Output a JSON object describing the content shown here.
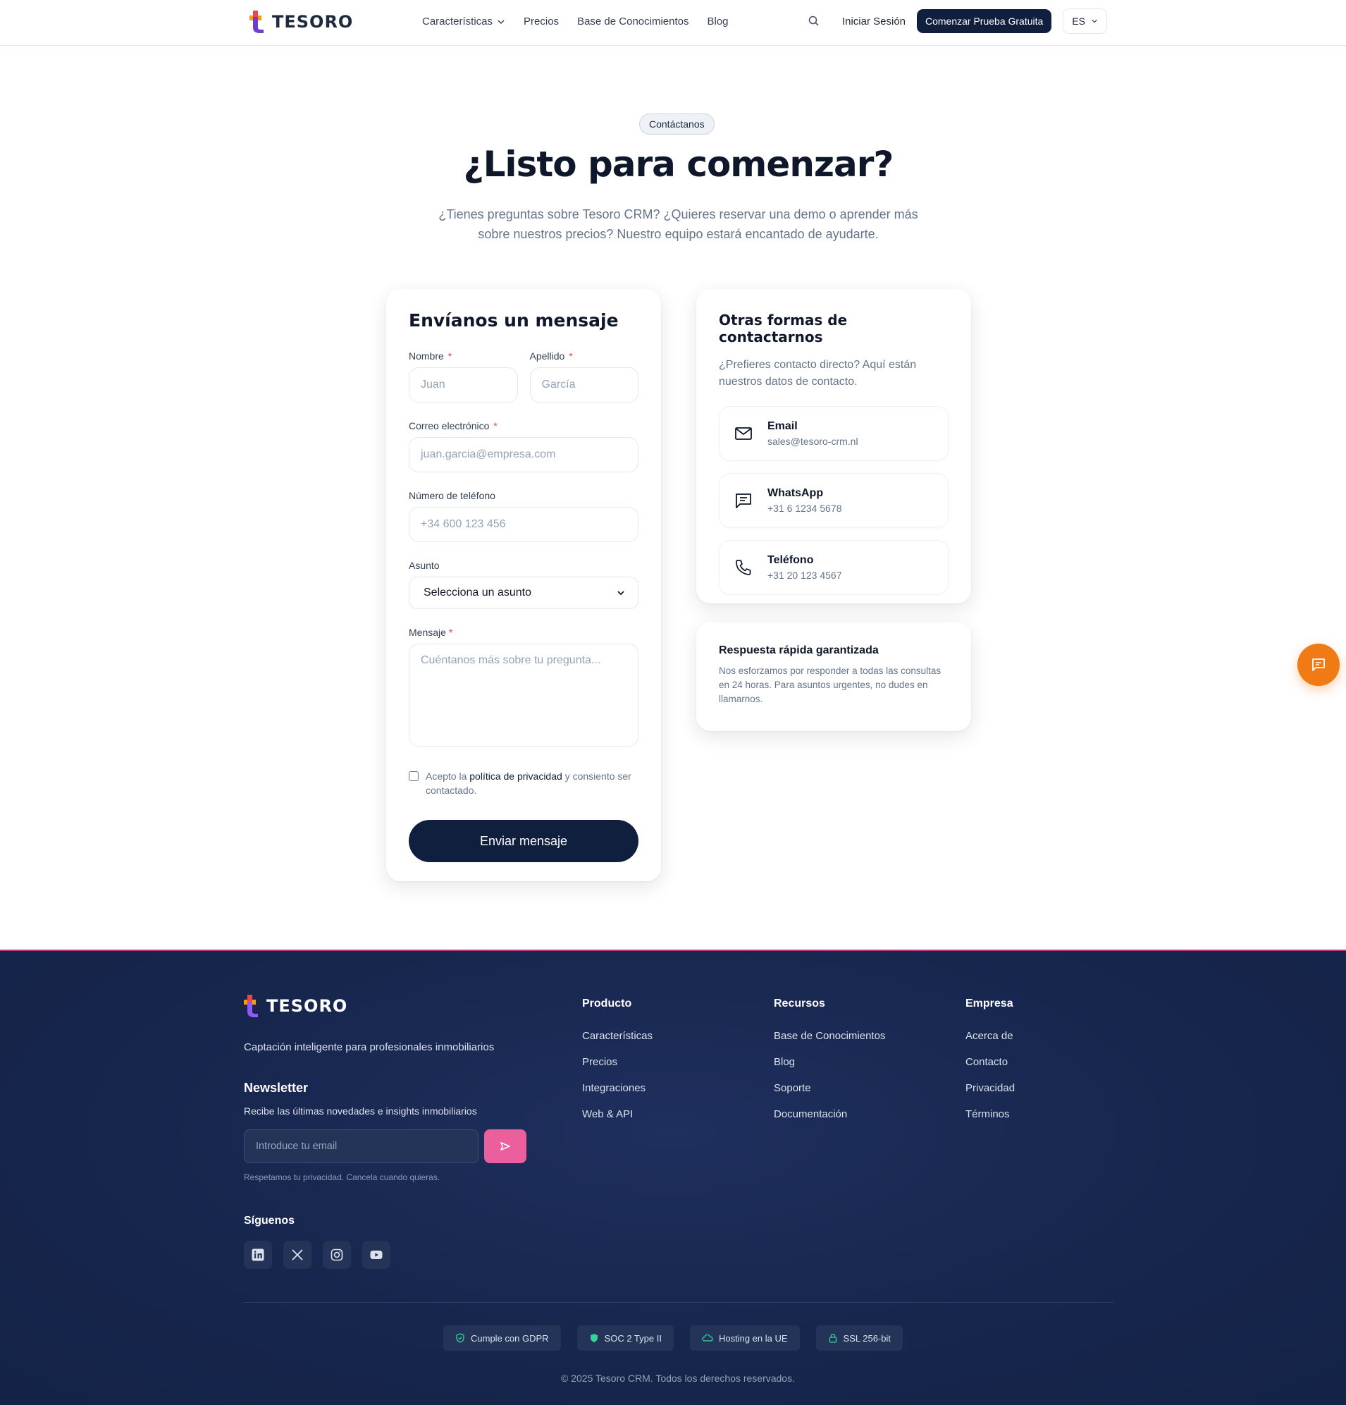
{
  "nav": {
    "brand": "TESORO",
    "links": [
      "Características",
      "Precios",
      "Base de Conocimientos",
      "Blog"
    ],
    "login": "Iniciar Sesión",
    "cta": "Comenzar Prueba Gratuita",
    "language": "ES"
  },
  "hero": {
    "badge": "Contáctanos",
    "title": "¿Listo para comenzar?",
    "subtitle": "¿Tienes preguntas sobre Tesoro CRM? ¿Quieres reservar una demo o aprender más sobre nuestros precios? Nuestro equipo estará encantado de ayudarte."
  },
  "form": {
    "title": "Envíanos un mensaje",
    "first_name_label": "Nombre",
    "first_name_placeholder": "Juan",
    "last_name_label": "Apellido",
    "last_name_placeholder": "García",
    "email_label": "Correo electrónico",
    "email_placeholder": "juan.garcia@empresa.com",
    "phone_label": "Número de teléfono",
    "phone_placeholder": "+34 600 123 456",
    "subject_label": "Asunto",
    "subject_value": "Selecciona un asunto",
    "message_label": "Mensaje",
    "message_placeholder": "Cuéntanos más sobre tu pregunta...",
    "required_mark": "*",
    "consent_prefix": "Acepto la",
    "consent_link": "política de privacidad",
    "consent_suffix": "y consiento ser contactado.",
    "submit": "Enviar mensaje"
  },
  "contact": {
    "title": "Otras formas de contactarnos",
    "subtitle": "¿Prefieres contacto directo? Aquí están nuestros datos de contacto.",
    "items": [
      {
        "title": "Email",
        "value": "sales@tesoro-crm.nl",
        "icon": "mail-icon"
      },
      {
        "title": "WhatsApp",
        "value": "+31 6 1234 5678",
        "icon": "chat-icon"
      },
      {
        "title": "Teléfono",
        "value": "+31 20 123 4567",
        "icon": "phone-icon"
      }
    ]
  },
  "quick": {
    "title": "Respuesta rápida garantizada",
    "text": "Nos esforzamos por responder a todas las consultas en 24 horas. Para asuntos urgentes, no dudes en llamarnos."
  },
  "footer": {
    "brand": "TESORO",
    "tagline": "Captación inteligente para profesionales inmobiliarios",
    "newsletter_title": "Newsletter",
    "newsletter_sub": "Recibe las últimas novedades e insights inmobiliarios",
    "newsletter_placeholder": "Introduce tu email",
    "newsletter_privacy": "Respetamos tu privacidad. Cancela cuando quieras.",
    "follow": "Síguenos",
    "columns": [
      {
        "title": "Producto",
        "links": [
          "Características",
          "Precios",
          "Integraciones",
          "Web & API"
        ]
      },
      {
        "title": "Recursos",
        "links": [
          "Base de Conocimientos",
          "Blog",
          "Soporte",
          "Documentación"
        ]
      },
      {
        "title": "Empresa",
        "links": [
          "Acerca de",
          "Contacto",
          "Privacidad",
          "Términos"
        ]
      }
    ],
    "badges": [
      "Cumple con GDPR",
      "SOC 2 Type II",
      "Hosting en la UE",
      "SSL 256-bit"
    ],
    "copyright": "© 2025 Tesoro CRM. Todos los derechos reservados."
  },
  "colors": {
    "navy": "#0f1f3d",
    "accent_orange": "#f07a14",
    "accent_pink": "#ec5f9d",
    "badge_green": "#34d399"
  }
}
